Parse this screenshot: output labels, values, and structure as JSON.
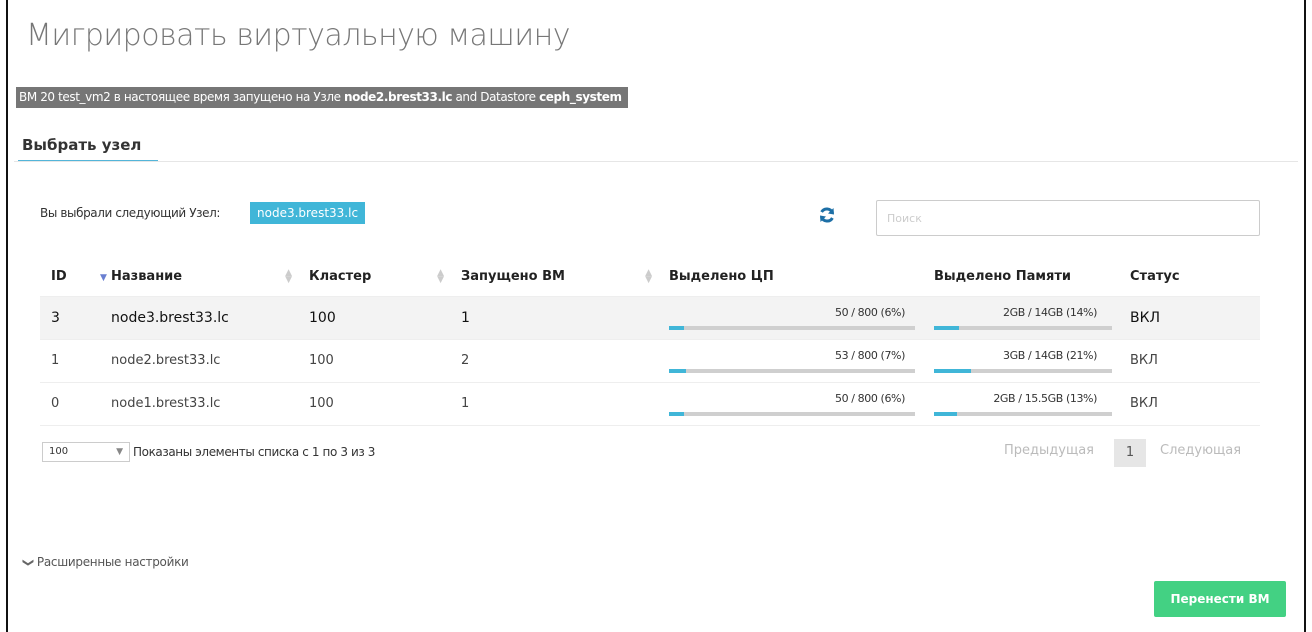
{
  "dialog": {
    "title": "Мигрировать виртуальную машину",
    "info": {
      "prefix": "ВМ 20 test_vm2 в настоящее время запущено на Узле ",
      "host": "node2.brest33.lc",
      "middle": " and Datastore ",
      "datastore": "ceph_system"
    }
  },
  "tab": {
    "label": "Выбрать узел"
  },
  "selection": {
    "label": "Вы выбрали следующий Узел:",
    "value": "node3.brest33.lc"
  },
  "search": {
    "placeholder": "Поиск",
    "value": ""
  },
  "table": {
    "headers": {
      "id": "ID",
      "name": "Название",
      "cluster": "Кластер",
      "running": "Запущено ВМ",
      "cpu": "Выделено ЦП",
      "memory": "Выделено Памяти",
      "status": "Статус"
    },
    "rows": [
      {
        "id": "3",
        "name": "node3.brest33.lc",
        "cluster": "100",
        "running": "1",
        "cpu": "50 / 800 (6%)",
        "cpu_pct": 6,
        "memory": "2GB / 14GB (14%)",
        "mem_pct": 14,
        "status": "ВКЛ"
      },
      {
        "id": "1",
        "name": "node2.brest33.lc",
        "cluster": "100",
        "running": "2",
        "cpu": "53 / 800 (7%)",
        "cpu_pct": 7,
        "memory": "3GB / 14GB (21%)",
        "mem_pct": 21,
        "status": "ВКЛ"
      },
      {
        "id": "0",
        "name": "node1.brest33.lc",
        "cluster": "100",
        "running": "1",
        "cpu": "50 / 800 (6%)",
        "cpu_pct": 6,
        "memory": "2GB / 15.5GB (13%)",
        "mem_pct": 13,
        "status": "ВКЛ"
      }
    ],
    "colors": {
      "bar_fill": "#40b6d8",
      "bar_track": "#cfcfcf"
    }
  },
  "footer": {
    "per_page": "100",
    "showing": "Показаны элементы списка с 1 по 3 из 3",
    "prev": "Предыдущая",
    "page": "1",
    "next": "Следующая"
  },
  "advanced": {
    "label": "Расширенные настройки"
  },
  "actions": {
    "migrate": "Перенести ВМ",
    "migrate_color": "#43d183"
  }
}
